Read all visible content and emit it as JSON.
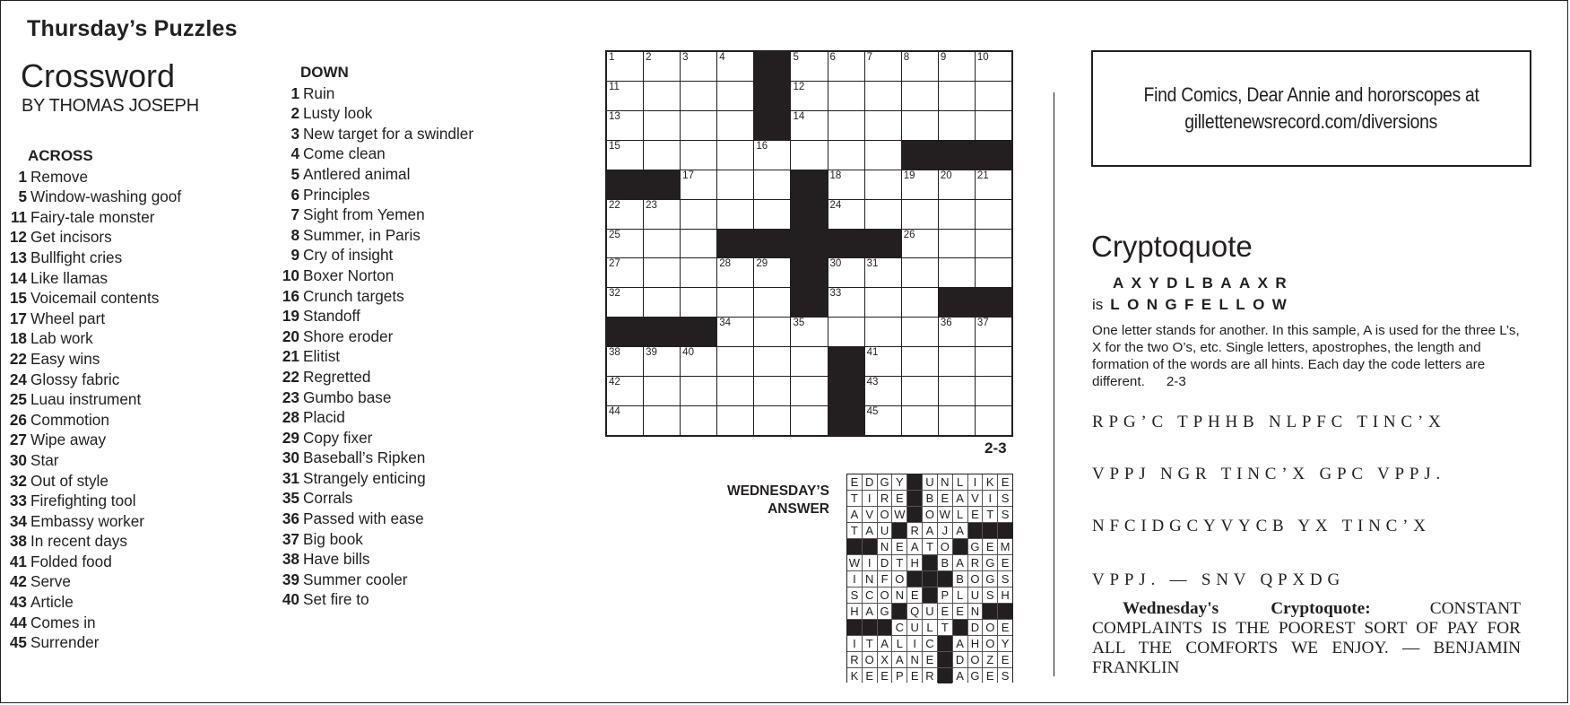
{
  "page_title": "Thursday’s Puzzles",
  "crossword": {
    "title": "Crossword",
    "byline": "BY THOMAS JOSEPH",
    "puzzle_date": "2-3",
    "across_heading": "ACROSS",
    "down_heading": "DOWN",
    "across": [
      {
        "num": "1",
        "clue": "Remove"
      },
      {
        "num": "5",
        "clue": "Window-washing goof"
      },
      {
        "num": "11",
        "clue": "Fairy-tale monster"
      },
      {
        "num": "12",
        "clue": "Get incisors"
      },
      {
        "num": "13",
        "clue": "Bullfight cries"
      },
      {
        "num": "14",
        "clue": "Like llamas"
      },
      {
        "num": "15",
        "clue": "Voicemail contents"
      },
      {
        "num": "17",
        "clue": "Wheel part"
      },
      {
        "num": "18",
        "clue": "Lab work"
      },
      {
        "num": "22",
        "clue": "Easy wins"
      },
      {
        "num": "24",
        "clue": "Glossy fabric"
      },
      {
        "num": "25",
        "clue": "Luau instrument"
      },
      {
        "num": "26",
        "clue": "Commotion"
      },
      {
        "num": "27",
        "clue": "Wipe away"
      },
      {
        "num": "30",
        "clue": "Star"
      },
      {
        "num": "32",
        "clue": "Out of style"
      },
      {
        "num": "33",
        "clue": "Firefighting tool"
      },
      {
        "num": "34",
        "clue": "Embassy worker"
      },
      {
        "num": "38",
        "clue": "In recent days"
      },
      {
        "num": "41",
        "clue": "Folded food"
      },
      {
        "num": "42",
        "clue": "Serve"
      },
      {
        "num": "43",
        "clue": "Article"
      },
      {
        "num": "44",
        "clue": "Comes in"
      },
      {
        "num": "45",
        "clue": "Surrender"
      }
    ],
    "down": [
      {
        "num": "1",
        "clue": "Ruin"
      },
      {
        "num": "2",
        "clue": "Lusty look"
      },
      {
        "num": "3",
        "clue": "New target for a swindler"
      },
      {
        "num": "4",
        "clue": "Come clean"
      },
      {
        "num": "5",
        "clue": "Antlered animal"
      },
      {
        "num": "6",
        "clue": "Principles"
      },
      {
        "num": "7",
        "clue": "Sight from Yemen"
      },
      {
        "num": "8",
        "clue": "Summer, in Paris"
      },
      {
        "num": "9",
        "clue": "Cry of insight"
      },
      {
        "num": "10",
        "clue": "Boxer Norton"
      },
      {
        "num": "16",
        "clue": "Crunch targets"
      },
      {
        "num": "19",
        "clue": "Standoff"
      },
      {
        "num": "20",
        "clue": "Shore eroder"
      },
      {
        "num": "21",
        "clue": "Elitist"
      },
      {
        "num": "22",
        "clue": "Regretted"
      },
      {
        "num": "23",
        "clue": "Gumbo base"
      },
      {
        "num": "28",
        "clue": "Placid"
      },
      {
        "num": "29",
        "clue": "Copy fixer"
      },
      {
        "num": "30",
        "clue": "Baseball’s Ripken"
      },
      {
        "num": "31",
        "clue": "Strangely enticing"
      },
      {
        "num": "35",
        "clue": "Corrals"
      },
      {
        "num": "36",
        "clue": "Passed with ease"
      },
      {
        "num": "37",
        "clue": "Big book"
      },
      {
        "num": "38",
        "clue": "Have bills"
      },
      {
        "num": "39",
        "clue": "Summer cooler"
      },
      {
        "num": "40",
        "clue": "Set fire to"
      }
    ],
    "grid": [
      [
        "1",
        "2",
        "3",
        "4",
        "#",
        "5",
        "6",
        "7",
        "8",
        "9",
        "10"
      ],
      [
        "11",
        "",
        "",
        "",
        "#",
        "12",
        "",
        "",
        "",
        "",
        ""
      ],
      [
        "13",
        "",
        "",
        "",
        "#",
        "14",
        "",
        "",
        "",
        "",
        ""
      ],
      [
        "15",
        "",
        "",
        "",
        "16",
        "",
        "",
        "",
        "#",
        "#",
        "#"
      ],
      [
        "#",
        "#",
        "17",
        "",
        "",
        "#",
        "18",
        "",
        "19",
        "20",
        "21"
      ],
      [
        "22",
        "23",
        "",
        "",
        "",
        "#",
        "24",
        "",
        "",
        "",
        ""
      ],
      [
        "25",
        "",
        "",
        "#",
        "#",
        "#",
        "#",
        "#",
        "26",
        "",
        ""
      ],
      [
        "27",
        "",
        "",
        "28",
        "29",
        "#",
        "30",
        "31",
        "",
        "",
        ""
      ],
      [
        "32",
        "",
        "",
        "",
        "",
        "#",
        "33",
        "",
        "",
        "#",
        "#"
      ],
      [
        "#",
        "#",
        "#",
        "34",
        "",
        "35",
        "",
        "",
        "",
        "36",
        "37"
      ],
      [
        "38",
        "39",
        "40",
        "",
        "",
        "",
        "#",
        "41",
        "",
        "",
        ""
      ],
      [
        "42",
        "",
        "",
        "",
        "",
        "",
        "#",
        "43",
        "",
        "",
        ""
      ],
      [
        "44",
        "",
        "",
        "",
        "",
        "",
        "#",
        "45",
        "",
        "",
        ""
      ]
    ]
  },
  "previous_answer": {
    "label_line1": "WEDNESDAY’S",
    "label_line2": "ANSWER",
    "grid": [
      "EDGY#UNLIKE",
      "TIRE#BEAVIS",
      "AVOW#OWLETS",
      "TAU#RAJA###",
      "##NEATO#GEM",
      "WIDTH#BARGE",
      "INFO###BOGS",
      "SCONE#PLUSH",
      "HAG#QUEEN##",
      "###CULT#DOE",
      "ITALIC#AHOY",
      "ROXANE#DOZE",
      "KEEPER#AGES"
    ]
  },
  "promo": {
    "line1": "Find Comics, Dear Annie and hororscopes at",
    "line2": "gillettenewsrecord.com/diversions"
  },
  "cryptoquote": {
    "title": "Cryptoquote",
    "sample_code": "AXYDLBAAXR",
    "sample_is": "is",
    "sample_answer": "LONGFELLOW",
    "instructions": "One letter stands for another. In this sample, A is used for the three L’s, X for the two O’s, etc. Single letters, apostrophes, the length and formation of the words are all hints. Each day the code letters are different.",
    "date": "2-3",
    "puzzle_lines": [
      "RPG’C  TPHHB  NLPFC  TINC’X",
      "VPPJ  NGR  TINC’X  GPC  VPPJ.",
      "NFCIDGCYVYCB  YX  TINC’X",
      "VPPJ.  —  SNV  QPXDG"
    ],
    "previous_label": "Wednesday's Cryptoquote:",
    "previous_answer": "CONSTANT COMPLAINTS IS THE POOREST SORT OF PAY FOR ALL THE COMFORTS WE ENJOY. — BENJAMIN FRANKLIN"
  }
}
